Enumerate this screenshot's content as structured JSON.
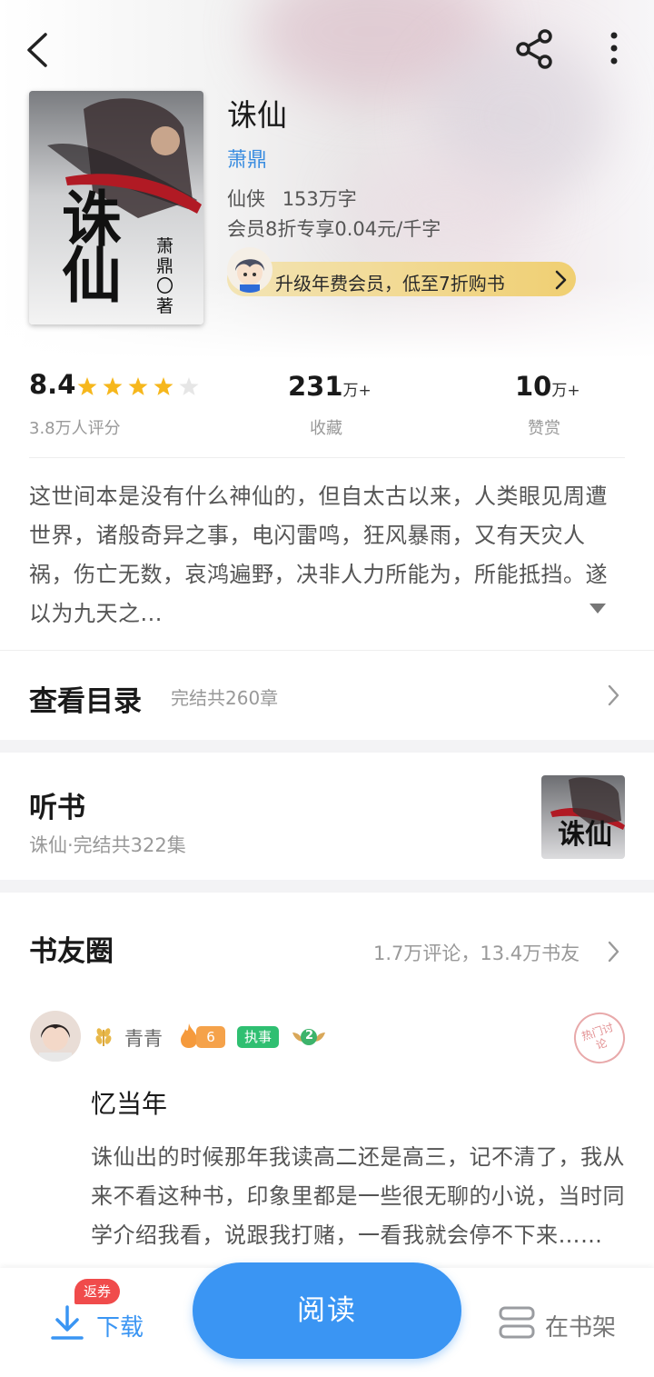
{
  "book": {
    "title": "诛仙",
    "author": "萧鼎",
    "genre_words": "仙侠",
    "word_count": "153万字",
    "member_price": "会员8折专享0.04元/千字",
    "promo": "升级年费会员，低至7折购书",
    "cover_text": "诛仙",
    "cover_author": "萧鼎〇著"
  },
  "stats": {
    "rating": "8.4",
    "stars": 4,
    "stars_max": 5,
    "rating_count": "3.8万人评分",
    "favorites_value": "231",
    "favorites_unit": "万+",
    "favorites_label": "收藏",
    "likes_value": "10",
    "likes_unit": "万+",
    "likes_label": "赞赏"
  },
  "description": "这世间本是没有什么神仙的，但自太古以来，人类眼见周遭世界，诸般奇异之事，电闪雷鸣，狂风暴雨，又有天灾人祸，伤亡无数，哀鸿遍野，决非人力所能为，所能抵挡。遂以为九天之...",
  "catalog": {
    "title": "查看目录",
    "info": "完结共260章"
  },
  "audio": {
    "title": "听书",
    "info": "诛仙·完结共322集"
  },
  "circle": {
    "title": "书友圈",
    "info": "1.7万评论，13.4万书友",
    "post": {
      "username": "青青",
      "fire_level": "6",
      "role_badge": "执事",
      "rank_badge": "2",
      "stamp": "热门讨论",
      "post_title": "忆当年",
      "post_body": "诛仙出的时候那年我读高二还是高三，记不清了，我从来不看这种书，印象里都是一些很无聊的小说，当时同学介绍我看，说跟我打赌，一看我就会停不下来……"
    }
  },
  "bottom": {
    "download_label": "下载",
    "coupon_badge": "返券",
    "read_label": "阅读",
    "shelf_label": "在书架"
  },
  "colors": {
    "accent_blue": "#3a95f3",
    "author_blue": "#3b8de0",
    "star_gold": "#f6b71c",
    "role_green": "#2fbf71",
    "fire_orange": "#f59a3c"
  }
}
